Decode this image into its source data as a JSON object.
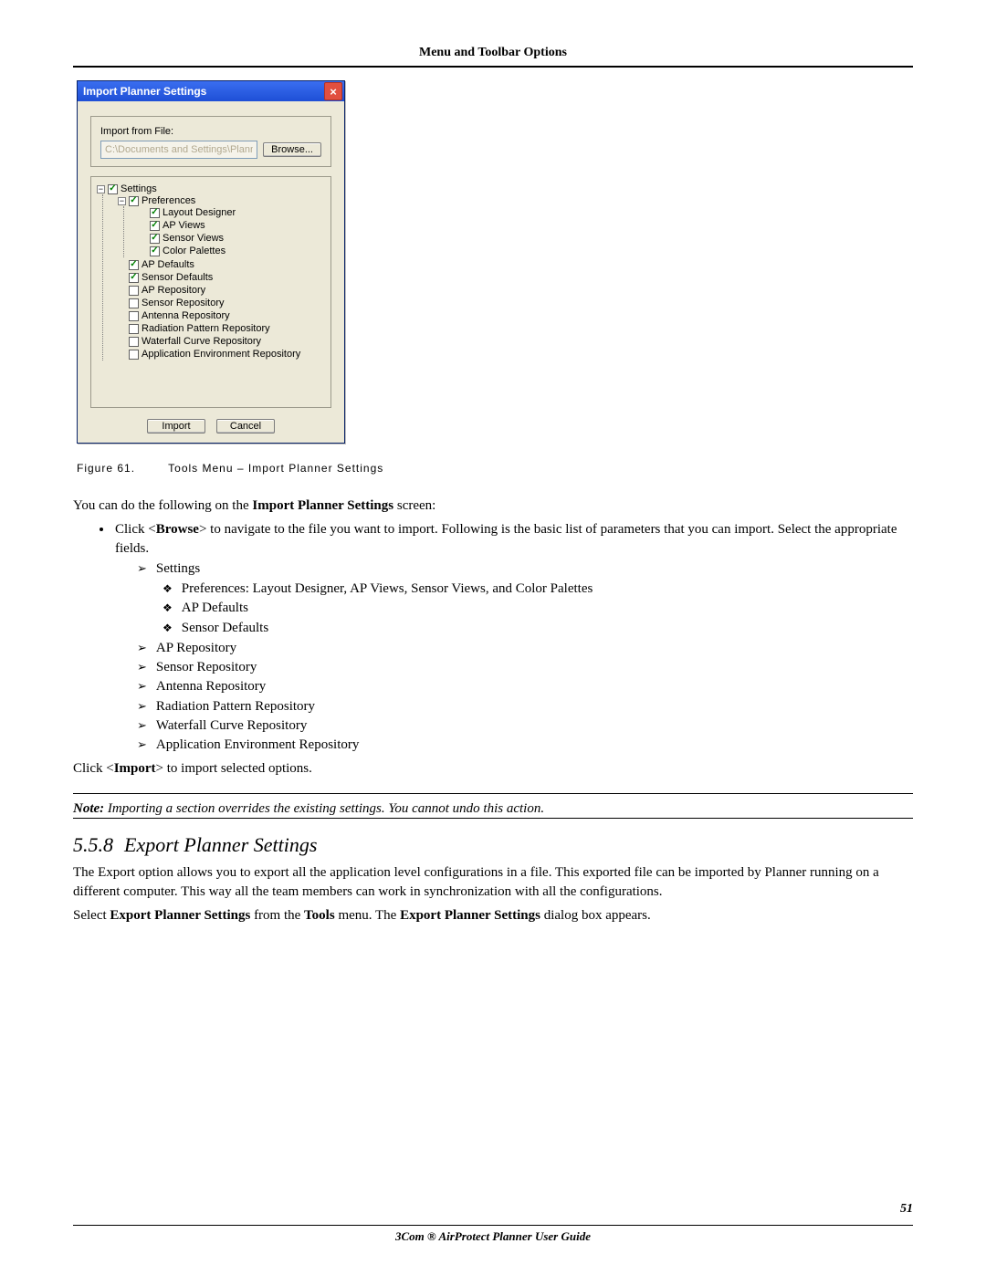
{
  "header": {
    "running_head": "Menu and Toolbar Options"
  },
  "dialog": {
    "title": "Import Planner Settings",
    "close_icon": "×",
    "file_label": "Import from File:",
    "file_value": "C:\\Documents and Settings\\Planner",
    "browse_label": "Browse...",
    "import_label": "Import",
    "cancel_label": "Cancel",
    "tree": {
      "settings": {
        "label": "Settings",
        "checked": true,
        "expander": "−"
      },
      "prefs": {
        "label": "Preferences",
        "checked": true,
        "expander": "−"
      },
      "layout": {
        "label": "Layout Designer",
        "checked": true
      },
      "apviews": {
        "label": "AP Views",
        "checked": true
      },
      "sviews": {
        "label": "Sensor Views",
        "checked": true
      },
      "palettes": {
        "label": "Color Palettes",
        "checked": true
      },
      "apdef": {
        "label": "AP Defaults",
        "checked": true
      },
      "sdef": {
        "label": "Sensor Defaults",
        "checked": true
      },
      "aprepo": {
        "label": "AP Repository",
        "checked": false
      },
      "srepo": {
        "label": "Sensor Repository",
        "checked": false
      },
      "antrepo": {
        "label": "Antenna Repository",
        "checked": false
      },
      "radrepo": {
        "label": "Radiation Pattern Repository",
        "checked": false
      },
      "wfrepo": {
        "label": "Waterfall Curve Repository",
        "checked": false
      },
      "apprepo": {
        "label": "Application Environment Repository",
        "checked": false
      }
    }
  },
  "figure": {
    "num": "Figure 61.",
    "caption": "Tools Menu – Import Planner Settings"
  },
  "doc": {
    "intro": "You can do the following on the ",
    "intro_bold": "Import Planner Settings",
    "intro_tail": " screen:",
    "bullet1_a": "Click <",
    "bullet1_b": "Browse",
    "bullet1_c": "> to navigate to the file you want to import. Following is the basic list of parameters that you can import. Select the appropriate fields.",
    "arr1": "Settings",
    "di1": "Preferences: Layout Designer, AP Views, Sensor Views, and Color Palettes",
    "di2": "AP Defaults",
    "di3": "Sensor Defaults",
    "arr2": "AP Repository",
    "arr3": "Sensor Repository",
    "arr4": "Antenna Repository",
    "arr5": "Radiation Pattern Repository",
    "arr6": "Waterfall Curve Repository",
    "arr7": "Application Environment Repository",
    "click_import_a": "Click <",
    "click_import_b": "Import",
    "click_import_c": "> to import selected options.",
    "note_a": "Note:",
    "note_b": " Importing a section overrides the existing settings. You cannot undo this action.",
    "sect_num": "5.5.8",
    "sect_title": "Export Planner Settings",
    "export_p1": "The Export option allows you to export all the application level configurations in a file. This exported file can be imported by Planner running on a different computer. This way all the team members can work in synchronization with all the configurations.",
    "export_p2_a": "Select ",
    "export_p2_b": "Export Planner Settings",
    "export_p2_c": " from the ",
    "export_p2_d": "Tools",
    "export_p2_e": " menu. The ",
    "export_p2_f": "Export Planner Settings",
    "export_p2_g": " dialog box appears."
  },
  "footer": {
    "page_num": "51",
    "product": "3Com ® AirProtect Planner User Guide"
  }
}
